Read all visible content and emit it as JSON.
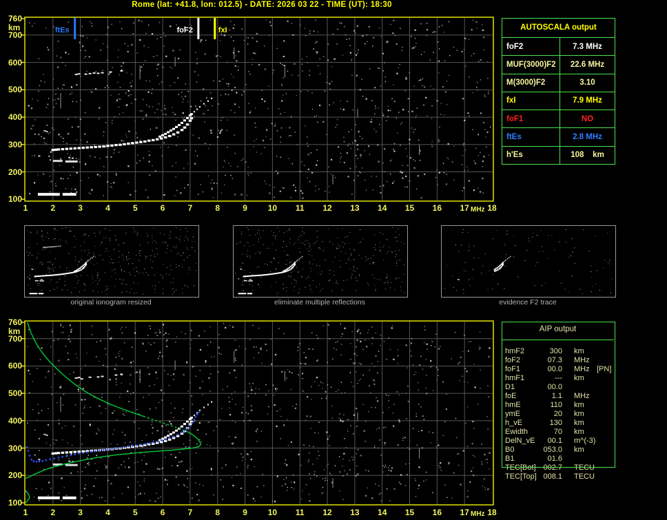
{
  "title": "Rome (lat: +41.8, lon: 012.5) - DATE: 2026 03 22 - TIME (UT): 18:30",
  "colors": {
    "accent_yellow": "#FFFF00",
    "tick_yellow": "#F3F35C",
    "frame_yellow": "#F2F200",
    "grid_gray": "#575757",
    "table_green": "#4CE64C",
    "trace_white": "#FFFFFF",
    "profile_green": "#00CC33",
    "restored_blue": "#2C52F2",
    "marker_blue": "#2979FF",
    "pale_yellow": "#F6F6A0",
    "red": "#FF2020",
    "aip_cream": "#E2E2A8",
    "caption_gray": "#B4B4B4"
  },
  "chart_data": {
    "type": "scatter",
    "title": "ionogram virtual height vs frequency",
    "x_label": "MHz",
    "y_label": "km",
    "x_range": [
      1,
      18
    ],
    "y_range": [
      100,
      760
    ],
    "x_ticks": [
      1,
      2,
      3,
      4,
      5,
      6,
      7,
      8,
      9,
      10,
      11,
      12,
      13,
      14,
      15,
      16,
      17,
      18
    ],
    "y_ticks": [
      760,
      700,
      600,
      500,
      400,
      300,
      200,
      100
    ],
    "markers": [
      {
        "label": "ftEs",
        "freq": 2.8,
        "color_key": "marker_blue"
      },
      {
        "label": "foF2",
        "freq": 7.3,
        "color_key": "trace_white"
      },
      {
        "label": "fxI",
        "freq": 7.9,
        "color_key": "accent_yellow"
      }
    ],
    "traces": {
      "o_trace": [
        [
          2.0,
          280
        ],
        [
          2.1,
          281
        ],
        [
          2.2,
          282
        ],
        [
          2.35,
          283
        ],
        [
          2.5,
          284
        ],
        [
          2.65,
          285
        ],
        [
          2.8,
          286
        ],
        [
          2.95,
          287
        ],
        [
          3.1,
          288
        ],
        [
          3.25,
          289
        ],
        [
          3.4,
          290
        ],
        [
          3.55,
          291
        ],
        [
          3.7,
          292
        ],
        [
          3.85,
          293
        ],
        [
          4.0,
          295
        ],
        [
          4.15,
          296
        ],
        [
          4.3,
          298
        ],
        [
          4.45,
          299
        ],
        [
          4.6,
          301
        ],
        [
          4.75,
          303
        ],
        [
          4.9,
          305
        ],
        [
          5.05,
          307
        ],
        [
          5.2,
          309
        ],
        [
          5.35,
          311
        ],
        [
          5.5,
          314
        ],
        [
          5.65,
          316
        ],
        [
          5.8,
          319
        ],
        [
          5.95,
          322
        ],
        [
          6.1,
          326
        ],
        [
          6.25,
          331
        ],
        [
          6.4,
          337
        ],
        [
          6.55,
          344
        ],
        [
          6.7,
          353
        ],
        [
          6.8,
          362
        ],
        [
          6.9,
          373
        ],
        [
          7.0,
          387
        ],
        [
          7.05,
          396
        ]
      ],
      "upper_arc": [
        [
          5.9,
          329
        ],
        [
          6.0,
          334
        ],
        [
          6.1,
          339
        ],
        [
          6.2,
          345
        ],
        [
          6.3,
          351
        ],
        [
          6.4,
          357
        ],
        [
          6.5,
          364
        ],
        [
          6.6,
          371
        ],
        [
          6.7,
          379
        ],
        [
          6.8,
          388
        ],
        [
          6.9,
          397
        ],
        [
          7.0,
          406
        ],
        [
          7.05,
          411
        ]
      ],
      "tail": [
        [
          7.15,
          420
        ],
        [
          7.25,
          429
        ],
        [
          7.35,
          438
        ],
        [
          7.5,
          449
        ],
        [
          7.65,
          459
        ],
        [
          7.78,
          469
        ]
      ],
      "second_hop": [
        [
          2.85,
          556
        ],
        [
          2.95,
          558
        ],
        [
          3.05,
          553
        ],
        [
          3.2,
          557
        ],
        [
          3.35,
          559
        ],
        [
          3.5,
          561
        ],
        [
          3.65,
          560
        ],
        [
          3.8,
          562
        ],
        [
          3.95,
          563
        ],
        [
          4.1,
          565
        ],
        [
          4.3,
          567
        ],
        [
          4.5,
          569
        ]
      ],
      "multiple_bars": [
        [
          2.0,
          2.35,
          240
        ],
        [
          2.45,
          2.9,
          238
        ]
      ],
      "es_bars": [
        [
          1.45,
          2.25,
          118
        ],
        [
          2.35,
          2.85,
          118
        ]
      ],
      "strays": [
        [
          1.7,
          350
        ],
        [
          1.78,
          347
        ],
        [
          2.6,
          252
        ],
        [
          2.72,
          250
        ],
        [
          1.5,
          258
        ]
      ]
    },
    "profile": {
      "topside_a": [
        [
          1.07,
          760
        ],
        [
          1.12,
          744
        ],
        [
          1.2,
          722
        ],
        [
          1.3,
          700
        ],
        [
          1.42,
          678
        ],
        [
          1.56,
          656
        ],
        [
          1.72,
          635
        ],
        [
          1.9,
          614
        ],
        [
          2.1,
          594
        ],
        [
          2.32,
          573
        ],
        [
          2.55,
          553
        ],
        [
          2.8,
          533
        ],
        [
          3.1,
          512
        ],
        [
          3.4,
          494
        ],
        [
          3.75,
          476
        ],
        [
          4.1,
          460
        ],
        [
          4.5,
          444
        ],
        [
          4.9,
          430
        ],
        [
          5.3,
          416
        ]
      ],
      "topside_b": [
        [
          5.3,
          416
        ],
        [
          5.7,
          402
        ],
        [
          6.1,
          389
        ],
        [
          6.5,
          375
        ],
        [
          6.9,
          360
        ]
      ],
      "topside_c": [
        [
          6.9,
          360
        ],
        [
          7.1,
          348
        ],
        [
          7.25,
          336
        ],
        [
          7.35,
          324
        ],
        [
          7.39,
          313
        ]
      ],
      "bottomside": [
        [
          7.39,
          313
        ],
        [
          7.32,
          306
        ],
        [
          7.15,
          301
        ],
        [
          6.9,
          298
        ],
        [
          6.6,
          295
        ],
        [
          6.3,
          292
        ],
        [
          6.0,
          290
        ],
        [
          5.6,
          287
        ],
        [
          5.2,
          284
        ],
        [
          4.8,
          280
        ],
        [
          4.4,
          276
        ],
        [
          4.0,
          271
        ],
        [
          3.6,
          265
        ],
        [
          3.2,
          258
        ],
        [
          2.8,
          250
        ],
        [
          2.4,
          241
        ],
        [
          2.1,
          233
        ],
        [
          1.8,
          224
        ],
        [
          1.55,
          214
        ],
        [
          1.35,
          205
        ],
        [
          1.18,
          197
        ],
        [
          1.05,
          191
        ],
        [
          1.0,
          189
        ]
      ],
      "e_hook": [
        [
          1.0,
          145
        ],
        [
          1.06,
          138
        ],
        [
          1.12,
          129
        ],
        [
          1.15,
          120
        ],
        [
          1.1,
          111
        ],
        [
          1.04,
          104
        ],
        [
          1.0,
          100
        ]
      ]
    },
    "restored": [
      [
        1.05,
        303
      ],
      [
        1.1,
        290
      ],
      [
        1.15,
        272
      ],
      [
        1.22,
        258
      ],
      [
        1.3,
        252
      ],
      [
        1.4,
        250
      ],
      [
        1.5,
        251
      ],
      [
        1.62,
        253
      ],
      [
        1.75,
        256
      ],
      [
        1.9,
        259
      ],
      [
        2.05,
        262
      ],
      [
        2.2,
        265
      ],
      [
        2.35,
        268
      ],
      [
        2.5,
        271
      ],
      [
        2.65,
        274
      ],
      [
        2.8,
        277
      ],
      [
        2.95,
        280
      ],
      [
        3.1,
        282
      ],
      [
        3.25,
        285
      ],
      [
        3.4,
        287
      ],
      [
        3.55,
        289
      ],
      [
        3.7,
        291
      ],
      [
        3.85,
        293
      ],
      [
        4.0,
        295
      ],
      [
        4.15,
        297
      ],
      [
        4.3,
        299
      ],
      [
        4.45,
        301
      ],
      [
        4.6,
        303
      ],
      [
        4.75,
        306
      ],
      [
        4.9,
        308
      ],
      [
        5.05,
        310
      ],
      [
        5.2,
        313
      ],
      [
        5.35,
        315
      ],
      [
        5.5,
        318
      ],
      [
        5.65,
        321
      ],
      [
        5.8,
        324
      ],
      [
        5.95,
        328
      ],
      [
        6.1,
        332
      ],
      [
        6.25,
        337
      ],
      [
        6.4,
        342
      ],
      [
        6.55,
        349
      ],
      [
        6.7,
        357
      ],
      [
        6.8,
        364
      ],
      [
        6.9,
        372
      ],
      [
        7.0,
        382
      ],
      [
        7.08,
        393
      ],
      [
        7.15,
        404
      ],
      [
        7.2,
        414
      ],
      [
        7.25,
        423
      ],
      [
        7.3,
        431
      ]
    ],
    "restored_isolated": [
      [
        1.02,
        142
      ]
    ],
    "streaks": [
      [
        2.28,
        432,
        488
      ],
      [
        5.17,
        538,
        589
      ],
      [
        8.6,
        612,
        655
      ],
      [
        10.45,
        545,
        583
      ],
      [
        13.1,
        398,
        430
      ],
      [
        15.35,
        262,
        300
      ],
      [
        12.2,
        155,
        190
      ],
      [
        6.45,
        585,
        620
      ]
    ],
    "noise": {
      "plot_counts": [
        1000,
        1000
      ],
      "thumb_counts": [
        380,
        330,
        110
      ],
      "seeds": [
        101,
        202,
        11,
        12,
        13
      ]
    }
  },
  "thumbnails": [
    {
      "caption": "original ionogram resized",
      "show": {
        "second_hop": true,
        "multiples": true,
        "es": true,
        "tail": true,
        "min_freq": 1,
        "strays": "all"
      }
    },
    {
      "caption": "eliminate multiple reflections",
      "show": {
        "second_hop": false,
        "multiples": true,
        "es": true,
        "tail": true,
        "min_freq": 1,
        "strays": "all"
      }
    },
    {
      "caption": "evidence F2 trace",
      "show": {
        "second_hop": false,
        "multiples": false,
        "es": false,
        "tail": true,
        "min_freq": 6.2,
        "strays": "some"
      }
    }
  ],
  "autoscala": {
    "title": "AUTOSCALA output",
    "rows": [
      {
        "label": "foF2",
        "value": "7.3 MHz",
        "color": "#FFFFFF"
      },
      {
        "label": "MUF(3000)F2",
        "value": "22.6 MHz",
        "color": "#F6F6A0"
      },
      {
        "label": "M(3000)F2",
        "value": "3.10",
        "color": "#F6F6A0"
      },
      {
        "label": "fxI",
        "value": "7.9 MHz",
        "color": "#FFFF00"
      },
      {
        "label": "foF1",
        "value": "NO",
        "color": "#FF2020"
      },
      {
        "label": "ftEs",
        "value": "2.8 MHz",
        "color": "#2E7FFF"
      },
      {
        "label": "h'Es",
        "value": "108    km",
        "color": "#F6F6A0"
      }
    ]
  },
  "aip": {
    "title": "AIP output",
    "rows": [
      {
        "label": "hmF2",
        "value": "300",
        "unit": "km",
        "extra": ""
      },
      {
        "label": "foF2",
        "value": "07.3",
        "unit": "MHz",
        "extra": ""
      },
      {
        "label": "foF1",
        "value": "00.0",
        "unit": "MHz",
        "extra": "[PN]"
      },
      {
        "label": "hmF1",
        "value": "---",
        "unit": "km",
        "extra": ""
      },
      {
        "label": "D1",
        "value": "00.0",
        "unit": "",
        "extra": ""
      },
      {
        "label": "foE",
        "value": "1.1",
        "unit": "MHz",
        "extra": ""
      },
      {
        "label": "hmE",
        "value": "110",
        "unit": "km",
        "extra": ""
      },
      {
        "label": "ymE",
        "value": "20",
        "unit": "km",
        "extra": ""
      },
      {
        "label": "h_vE",
        "value": "130",
        "unit": "km",
        "extra": ""
      },
      {
        "label": "Ewidth",
        "value": "70",
        "unit": "km",
        "extra": ""
      },
      {
        "label": "DelN_vE",
        "value": "00.1",
        "unit": "m^(-3)",
        "extra": ""
      },
      {
        "label": "B0",
        "value": "053.0",
        "unit": "km",
        "extra": ""
      },
      {
        "label": "B1",
        "value": "01.6",
        "unit": "",
        "extra": ""
      },
      {
        "label": "TEC[Bot]",
        "value": "002.7",
        "unit": "TECU",
        "extra": ""
      },
      {
        "label": "TEC[Top]",
        "value": "008.1",
        "unit": "TECU",
        "extra": ""
      }
    ]
  }
}
